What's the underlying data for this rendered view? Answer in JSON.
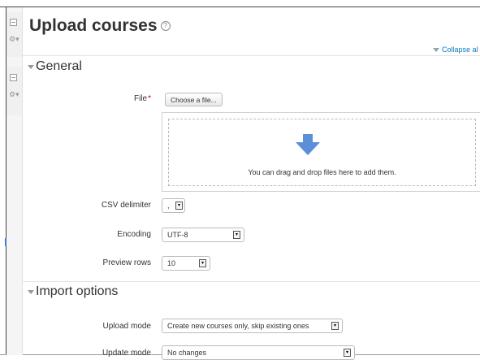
{
  "page": {
    "title": "Upload courses",
    "help_icon": "?",
    "collapse_all": "Collapse al"
  },
  "sections": {
    "general": "General",
    "import_options": "Import options"
  },
  "general": {
    "file_label": "File",
    "required_mark": "*",
    "choose_file_button": "Choose a file...",
    "drop_text": "You can drag and drop files here to add them.",
    "csv_delimiter_label": "CSV delimiter",
    "csv_delimiter_value": ",",
    "encoding_label": "Encoding",
    "encoding_value": "UTF-8",
    "preview_rows_label": "Preview rows",
    "preview_rows_value": "10"
  },
  "import_options": {
    "upload_mode_label": "Upload mode",
    "upload_mode_value": "Create new courses only, skip existing ones",
    "update_mode_label": "Update mode",
    "update_mode_value": "No changes"
  },
  "icons": {
    "drop_arrow": "arrow-down-icon",
    "select_arrow": "chevron-down-icon",
    "gear": "gear-icon",
    "collapse": "collapse-triangle-icon"
  },
  "colors": {
    "link": "#0b78c2",
    "required": "#cc0000",
    "drop_arrow": "#5b8fd8"
  }
}
